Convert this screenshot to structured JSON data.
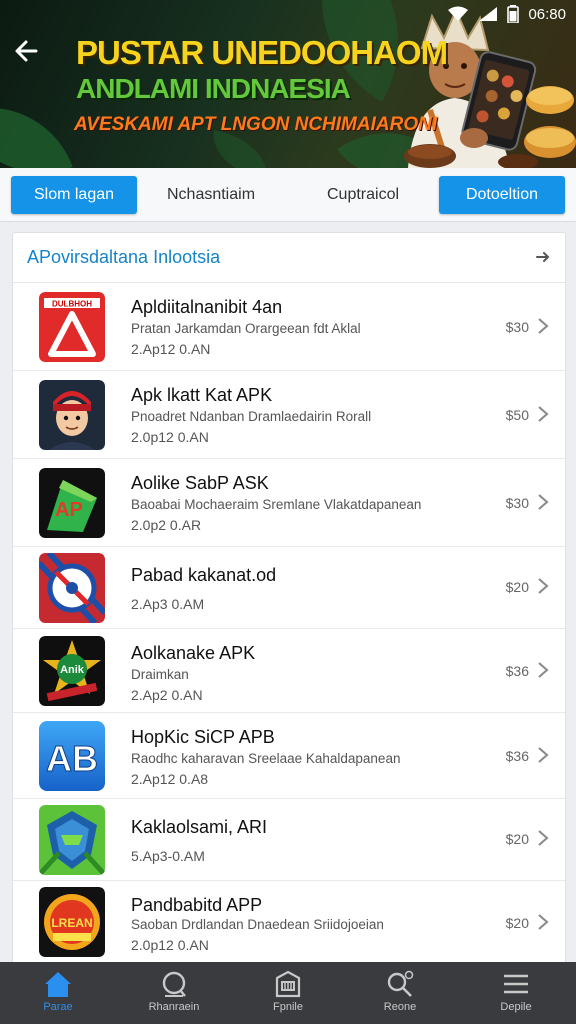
{
  "status_bar": {
    "time": "06:80"
  },
  "banner": {
    "line1": "PUSTAR UNEDOOHAOM",
    "line2": "ANDLAMI INDNAESIA",
    "line3": "AVESKAMI APT LNGON NCHIMAIARONI"
  },
  "tabs": [
    {
      "label": "Slom lagan",
      "active": true
    },
    {
      "label": "Nchasntiaim",
      "active": false
    },
    {
      "label": "Cuptraicol",
      "active": false
    },
    {
      "label": "Dotoeltion",
      "active": true
    }
  ],
  "section": {
    "title": "APovirsdaltana Inlootsia"
  },
  "apps": [
    {
      "name": "Apldiitalnanibit 4an",
      "desc": "Pratan Jarkamdan Orargeean fdt Aklal",
      "version": "2.Ap12 0.AN",
      "price": "$30",
      "icon": "red-triangle-app-icon",
      "icon_text": "DULBHOH"
    },
    {
      "name": "Apk lkatt Kat APK",
      "desc": "Pnoadret Ndanban Dramlaedairin Rorall",
      "version": "2.0p12 0.AN",
      "price": "$50",
      "icon": "cartoon-avatar-app-icon",
      "icon_text": ""
    },
    {
      "name": "Aolike SabP ASK",
      "desc": "Baoabai Mochaeraim Sremlane Vlakatdapanean",
      "version": "2.0p2 0.AR",
      "price": "$30",
      "icon": "green-a-app-icon",
      "icon_text": "AP"
    },
    {
      "name": "Pabad kakanat.od",
      "desc": "",
      "version": "2.Ap3 0.AM",
      "price": "$20",
      "icon": "no-sign-app-icon",
      "icon_text": ""
    },
    {
      "name": "Aolkanake APK",
      "desc": "Draimkan",
      "version": "2.Ap2 0.AN",
      "price": "$36",
      "icon": "gold-star-badge-app-icon",
      "icon_text": "Anik"
    },
    {
      "name": "HopKic SiCP APB",
      "desc": "Raodhc kaharavan Sreelaae Kahaldapanean",
      "version": "2.Ap12 0.A8",
      "price": "$36",
      "icon": "blue-ab-app-icon",
      "icon_text": "AB"
    },
    {
      "name": "Kaklaolsami, ARI",
      "desc": "",
      "version": "5.Ap3-0.AM",
      "price": "$20",
      "icon": "green-shield-app-icon",
      "icon_text": ""
    },
    {
      "name": "Pandbabitd APP",
      "desc": "Saoban Drdlandan Dnaedean Sriidojoeian",
      "version": "2.0p12 0.AN",
      "price": "$20",
      "icon": "orange-badge-app-icon",
      "icon_text": "LREAN"
    }
  ],
  "bottom_nav": [
    {
      "label": "Parae",
      "icon": "home-icon",
      "active": true
    },
    {
      "label": "Rhanraein",
      "icon": "search-circle-icon",
      "active": false
    },
    {
      "label": "Fpnile",
      "icon": "store-icon",
      "active": false
    },
    {
      "label": "Reone",
      "icon": "magnifier-icon",
      "active": false
    },
    {
      "label": "Depile",
      "icon": "menu-icon",
      "active": false
    }
  ],
  "colors": {
    "accent": "#1493e8",
    "section_title": "#1583c9",
    "nav_bg": "#3a3b3f",
    "nav_active": "#2b8ff0"
  }
}
